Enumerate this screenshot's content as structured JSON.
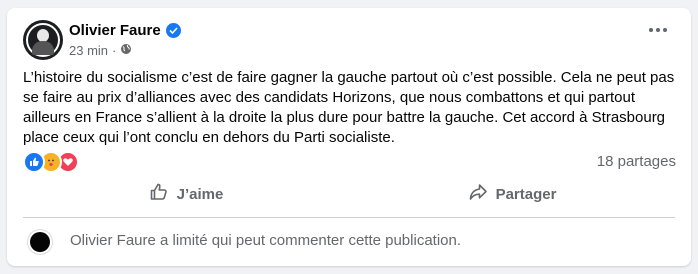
{
  "post": {
    "author": "Olivier Faure",
    "time": "23 min",
    "separator": "·",
    "text": "L’histoire du socialisme c’est de faire gagner la gauche partout où c’est possible. Cela ne peut pas se faire au prix d’alliances avec des candidats Horizons, que nous combattons et qui partout ailleurs en France s’allient à la droite la plus dure pour battre la gauche. Cet accord à Strasbourg place ceux qui l’ont conclu en dehors du Parti socialiste.",
    "shares": "18 partages",
    "reactions": [
      "like-icon",
      "care-icon",
      "love-icon"
    ]
  },
  "actions": {
    "like_label": "J’aime",
    "share_label": "Partager"
  },
  "footer": {
    "text": "Olivier Faure a limité qui peut commenter cette publication."
  },
  "colors": {
    "verified": "#1877f2",
    "secondary_text": "#65676b"
  }
}
